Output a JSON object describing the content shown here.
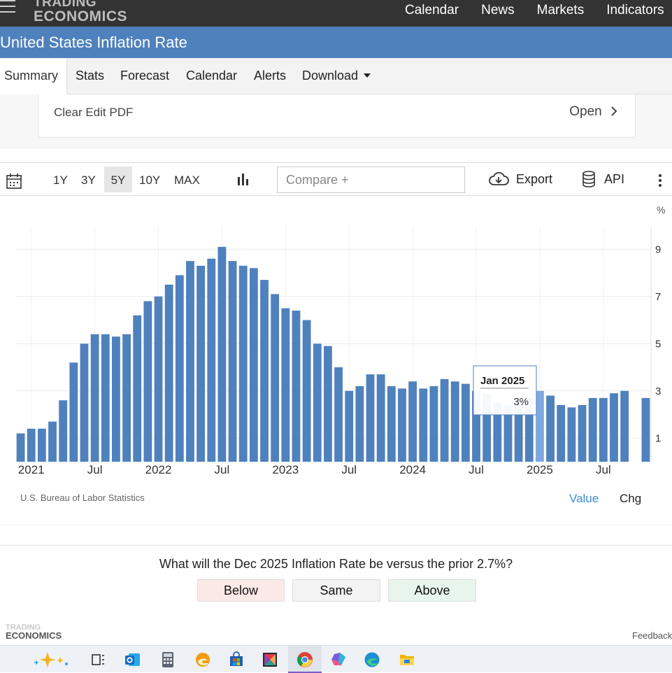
{
  "nav": {
    "logo_line1": "TRADING",
    "logo_line2": "ECONOMICS",
    "links": [
      "Calendar",
      "News",
      "Markets",
      "Indicators"
    ]
  },
  "page_title": "United States Inflation Rate",
  "tabs": {
    "summary": "Summary",
    "stats": "Stats",
    "forecast": "Forecast",
    "calendar": "Calendar",
    "alerts": "Alerts",
    "download": "Download"
  },
  "pdf_card": {
    "label": "Clear Edit PDF",
    "action": "Open"
  },
  "toolbar": {
    "ranges": [
      "1Y",
      "3Y",
      "5Y",
      "10Y",
      "MAX"
    ],
    "selected_range": "5Y",
    "compare_placeholder": "Compare +",
    "export": "Export",
    "api": "API"
  },
  "chart_data": {
    "type": "bar",
    "unit": "%",
    "bar_color": "#4f81bd",
    "highlight_color": "#7ea8df",
    "x_tick_labels": [
      "2021",
      "Jul",
      "2022",
      "Jul",
      "2023",
      "Jul",
      "2024",
      "Jul",
      "2025",
      "Jul"
    ],
    "y_ticks": [
      1,
      3,
      5,
      7,
      9
    ],
    "ylim": [
      0,
      10
    ],
    "grid": true,
    "categories": [
      "Dec 2020",
      "Jan 2021",
      "Feb 2021",
      "Mar 2021",
      "Apr 2021",
      "May 2021",
      "Jun 2021",
      "Jul 2021",
      "Aug 2021",
      "Sep 2021",
      "Oct 2021",
      "Nov 2021",
      "Dec 2021",
      "Jan 2022",
      "Feb 2022",
      "Mar 2022",
      "Apr 2022",
      "May 2022",
      "Jun 2022",
      "Jul 2022",
      "Aug 2022",
      "Sep 2022",
      "Oct 2022",
      "Nov 2022",
      "Dec 2022",
      "Jan 2023",
      "Feb 2023",
      "Mar 2023",
      "Apr 2023",
      "May 2023",
      "Jun 2023",
      "Jul 2023",
      "Aug 2023",
      "Sep 2023",
      "Oct 2023",
      "Nov 2023",
      "Dec 2023",
      "Jan 2024",
      "Feb 2024",
      "Mar 2024",
      "Apr 2024",
      "May 2024",
      "Jun 2024",
      "Jul 2024",
      "Aug 2024",
      "Sep 2024",
      "Oct 2024",
      "Nov 2024",
      "Dec 2024",
      "Jan 2025",
      "Feb 2025",
      "Mar 2025",
      "Apr 2025",
      "May 2025",
      "Jun 2025",
      "Jul 2025",
      "Aug 2025",
      "Sep 2025",
      "Oct 2025",
      "Nov 2025"
    ],
    "values": [
      1.2,
      1.4,
      1.4,
      1.7,
      2.6,
      4.2,
      5.0,
      5.4,
      5.4,
      5.3,
      5.4,
      6.2,
      6.8,
      7.0,
      7.5,
      7.9,
      8.5,
      8.3,
      8.6,
      9.1,
      8.5,
      8.3,
      8.2,
      7.7,
      7.1,
      6.5,
      6.4,
      6.0,
      5.0,
      4.9,
      4.0,
      3.0,
      3.2,
      3.7,
      3.7,
      3.2,
      3.1,
      3.4,
      3.1,
      3.2,
      3.5,
      3.4,
      3.3,
      3.0,
      2.9,
      2.5,
      2.4,
      2.6,
      2.7,
      3.0,
      2.8,
      2.4,
      2.3,
      2.4,
      2.7,
      2.7,
      2.9,
      3.0,
      null,
      2.7
    ],
    "highlight_index": 49,
    "tooltip": {
      "title": "Jan 2025",
      "value": "3%"
    }
  },
  "source": "U.S. Bureau of Labor Statistics",
  "value_tab": "Value",
  "chg_tab": "Chg",
  "question": {
    "text": "What will the Dec 2025 Inflation Rate be versus the prior 2.7%?",
    "below": "Below",
    "same": "Same",
    "above": "Above",
    "below_bg": "#fbe9e7",
    "same_bg": "#f3f3f3",
    "above_bg": "#e8f5ec"
  },
  "footer": {
    "logo_line1": "TRADING",
    "logo_line2": "ECONOMICS",
    "feedback": "Feedback"
  },
  "taskbar": {
    "icons": [
      "copilot-icon",
      "task-view-icon",
      "outlook-icon",
      "calculator-icon",
      "edge-dev-icon",
      "store-icon",
      "photo-editor-icon",
      "chrome-icon",
      "m365-icon",
      "edge-icon",
      "file-explorer-icon"
    ]
  }
}
